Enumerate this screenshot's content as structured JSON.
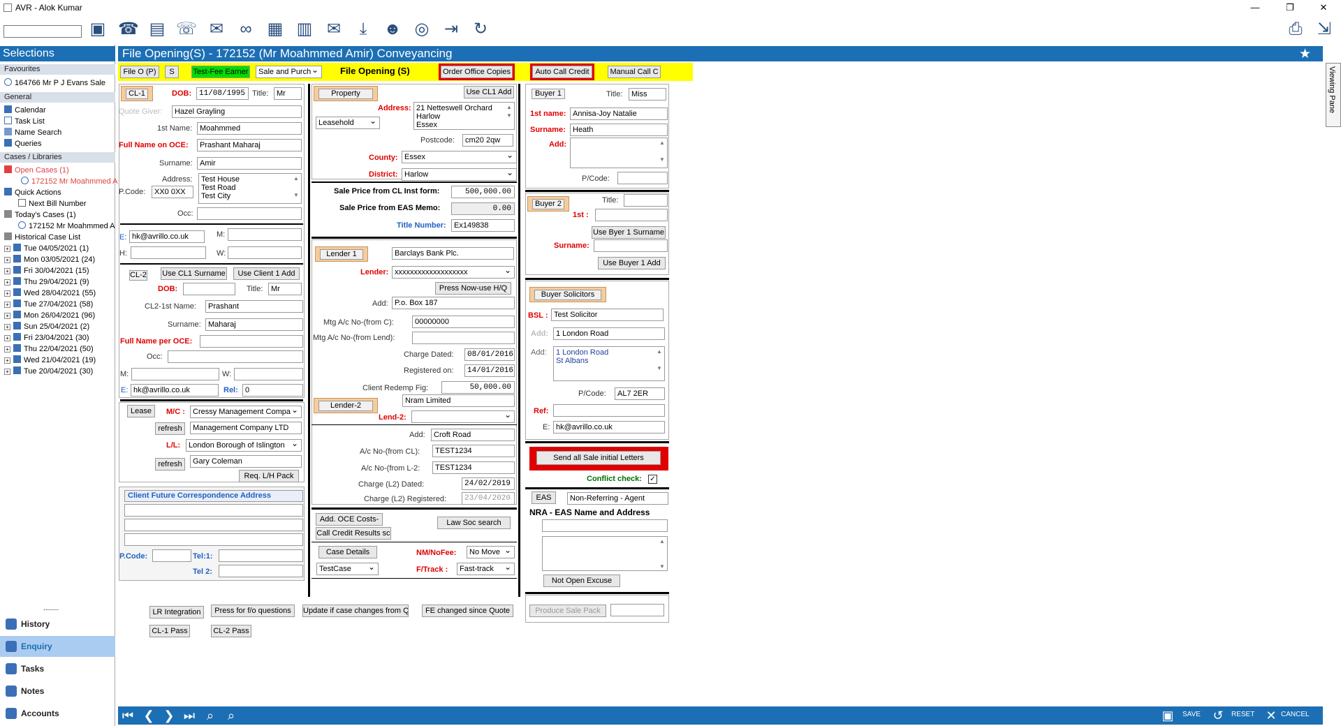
{
  "window": {
    "title": "AVR - Alok Kumar",
    "min": "—",
    "max": "❐",
    "close": "✕"
  },
  "toolbar": {
    "search_value": "",
    "icons": [
      "add-case-icon",
      "phone-in-icon",
      "notes-icon",
      "phone-out-icon",
      "email-icon",
      "link-icon",
      "calculator-icon",
      "calendar-icon",
      "mail-open-icon",
      "download-icon",
      "people-icon",
      "coins-icon",
      "export-icon",
      "refresh-icon",
      "print-icon",
      "logout-icon"
    ]
  },
  "sidebar": {
    "title": "Selections",
    "favourites_header": "Favourites",
    "favourite_item": "164766 Mr P J Evans Sale",
    "general_header": "General",
    "general_items": [
      "Calendar",
      "Task List",
      "Name Search",
      "Queries"
    ],
    "cases_header": "Cases / Libraries",
    "open_cases": "Open Cases  (1)",
    "open_case_item": "172152 Mr Moahmmed A",
    "quick_actions": "Quick Actions",
    "next_bill": "Next Bill Number",
    "todays_cases": "Today's Cases  (1)",
    "todays_case_item": "172152 Mr Moahmmed A",
    "historical": "Historical Case List",
    "history_items": [
      "Tue 04/05/2021  (1)",
      "Mon 03/05/2021  (24)",
      "Fri 30/04/2021  (15)",
      "Thu 29/04/2021  (9)",
      "Wed 28/04/2021  (55)",
      "Tue 27/04/2021  (58)",
      "Mon 26/04/2021  (96)",
      "Sun 25/04/2021  (2)",
      "Fri 23/04/2021  (30)",
      "Thu 22/04/2021  (50)",
      "Wed 21/04/2021  (19)",
      "Tue 20/04/2021  (30)"
    ],
    "grip": "........",
    "bottom_nav": [
      "History",
      "Enquiry",
      "Tasks",
      "Notes",
      "Accounts"
    ]
  },
  "header": {
    "title": "File Opening(S) - 172152 (Mr Moahmmed Amir) Conveyancing",
    "star": "★"
  },
  "viewing_pane": "Viewing Pane",
  "topbar": {
    "file_o_p": "File O (P)",
    "s": "S",
    "fee_earner": "Test-Fee Earner",
    "sale_purch": "Sale and Purch",
    "file_opening": "File Opening (S)",
    "order_office": "Order Office Copies",
    "auto_call": "Auto Call Credit",
    "manual_call": "Manual Call C"
  },
  "client1": {
    "btn": "CL-1",
    "dob_label": "DOB:",
    "dob": "11/08/1995",
    "title_label": "Title:",
    "title": "Mr",
    "quote_giver_label": "Quote Giver:",
    "quote_giver": "Hazel Grayling",
    "first_name_label": "1st Name:",
    "first_name": "Moahmmed",
    "full_name_label": "Full Name on OCE:",
    "full_name": "Prashant Maharaj",
    "surname_label": "Surname:",
    "surname": "Amir",
    "address_label": "Address:",
    "address": [
      "Test House",
      "Test Road",
      "Test City"
    ],
    "pcode_label": "P.Code:",
    "pcode": "XX0 0XX",
    "occ_label": "Occ:",
    "occ": "",
    "e_label": "E:",
    "email": "hk@avrillo.co.uk",
    "m_label": "M:",
    "h_label": "H:",
    "w_label": "W:"
  },
  "client2": {
    "btn": "CL-2",
    "use_cl1_surname": "Use CL1 Surname",
    "use_client1_add": "Use Client 1 Add",
    "dob_label": "DOB:",
    "title_label": "Title:",
    "title": "Mr",
    "first_name_label": "CL2-1st Name:",
    "first_name": "Prashant",
    "surname_label": "Surname:",
    "surname": "Maharaj",
    "full_name_label": "Full Name per OCE:",
    "occ_label": "Occ:",
    "m_label": "M:",
    "w_label": "W:",
    "e_label": "E:",
    "email": "hk@avrillo.co.uk",
    "rel_label": "Rel:",
    "rel": "0"
  },
  "lease": {
    "lease_btn": "Lease",
    "mc_label": "M/C :",
    "mc": "Cressy Management Compa",
    "refresh": "refresh",
    "mgmt": "Management Company LTD",
    "ll_label": "L/L:",
    "ll": "London Borough of Islington",
    "refresh2": "refresh",
    "ll_contact": "Gary Coleman",
    "req_lh": "Req. L/H Pack"
  },
  "future": {
    "title": "Client Future Correspondence Address",
    "pcode_label": "P.Code:",
    "tel1_label": "Tel:1:",
    "tel2_label": "Tel 2:"
  },
  "bottom_buttons": {
    "lr": "LR Integration",
    "press_fo": "Press for f/o questions",
    "update_case": "Update if case changes from Q",
    "fe_changed": "FE changed since Quote",
    "cl1_pass": "CL-1 Pass",
    "cl2_pass": "CL-2 Pass"
  },
  "property": {
    "btn": "Property",
    "use_cl1_add": "Use CL1 Add",
    "tenure": "Leasehold",
    "address_label": "Address:",
    "address": [
      "21 Netteswell Orchard",
      "Harlow",
      "Essex"
    ],
    "postcode_label": "Postcode:",
    "postcode": "cm20 2qw",
    "county_label": "County:",
    "county": "Essex",
    "district_label": "District:",
    "district": "Harlow",
    "sale_price_cl_label": "Sale Price from CL Inst form:",
    "sale_price_cl": "500,000.00",
    "sale_price_eas_label": "Sale Price from EAS Memo:",
    "sale_price_eas": "0.00",
    "title_no_label": "Title Number:",
    "title_no": "Ex149838"
  },
  "lender": {
    "btn1": "Lender 1",
    "lender_name": "Barclays Bank Plc.",
    "lender_label": "Lender:",
    "lender_sel": "xxxxxxxxxxxxxxxxxxx",
    "press_now": "Press Now-use H/Q",
    "add_label": "Add:",
    "add": "P.o. Box 187",
    "mtg_ac_c_label": "Mtg  A/c No-(from C):",
    "mtg_ac_c": "00000000",
    "mtg_ac_lend_label": "Mtg A/c No-(from Lend):",
    "mtg_ac_lend": "",
    "charge_dated_label": "Charge Dated:",
    "charge_dated": "08/01/2016",
    "registered_label": "Registered on:",
    "registered": "14/01/2016",
    "redemp_label": "Client Redemp Fig:",
    "redemp": "50,000.00",
    "btn2": "Lender-2",
    "lender2_name": "Nram Limited",
    "lend2_label": "Lend-2:",
    "add2_label": "Add:",
    "add2": "Croft Road",
    "ac_cl_label": "A/c No-(from CL):",
    "ac_cl": "TEST1234",
    "ac_l2_label": "A/c No-(from L-2:",
    "ac_l2": "TEST1234",
    "charge_l2_label": "Charge (L2) Dated:",
    "charge_l2": "24/02/2019",
    "charge_l2_reg_label": "Charge (L2) Registered:",
    "charge_l2_reg": "23/04/2020"
  },
  "misc": {
    "add_oce": "Add. OCE Costs-",
    "law_soc": "Law Soc search",
    "call_credit": "Call Credit Results sc",
    "case_details": "Case Details",
    "nm_label": "NM/NoFee:",
    "nm": "No Move",
    "case_type": "TestCase",
    "ftrack_label": "F/Track :",
    "ftrack": "Fast-track"
  },
  "buyer": {
    "btn1": "Buyer 1",
    "title_label": "Title:",
    "title": "Miss",
    "first_label": "1st name:",
    "first": "Annisa-Joy Natalie",
    "surname_label": "Surname:",
    "surname": "Heath",
    "add_label": "Add:",
    "pcode_label": "P/Code:",
    "btn2": "Buyer 2",
    "title2_label": "Title:",
    "first2_label": "1st :",
    "use_surname": "Use Byer 1 Surname",
    "surname2_label": "Surname:",
    "use_add": "Use Buyer 1 Add"
  },
  "solicitors": {
    "btn": "Buyer Solicitors",
    "bsl_label": "BSL :",
    "bsl": "Test Solicitor",
    "add_label": "Add:",
    "add": "1 London Road",
    "add2_label": "Add:",
    "add2": [
      "1 London Road",
      "St Albans"
    ],
    "pcode_label": "P/Code:",
    "pcode": "AL7 2ER",
    "ref_label": "Ref:",
    "e_label": "E:",
    "email": "hk@avrillo.co.uk"
  },
  "letters": {
    "send_all": "Send all Sale initial Letters",
    "conflict": "Conflict check:",
    "conflict_checked": "✓"
  },
  "eas": {
    "btn": "EAS",
    ".": ".:",
    "value": "Non-Referring - Agent",
    "nra_title": "NRA - EAS Name and Address",
    "not_open": "Not Open Excuse",
    "produce": "Produce Sale Pack"
  },
  "footer": {
    "save": "SAVE",
    "reset": "RESET",
    "cancel": "CANCEL"
  },
  "colors": {
    "accent": "#1c6fb4",
    "yellow": "#ffff00",
    "red": "#e00000",
    "green": "#00cc00",
    "orange": "#f5cc9e"
  }
}
